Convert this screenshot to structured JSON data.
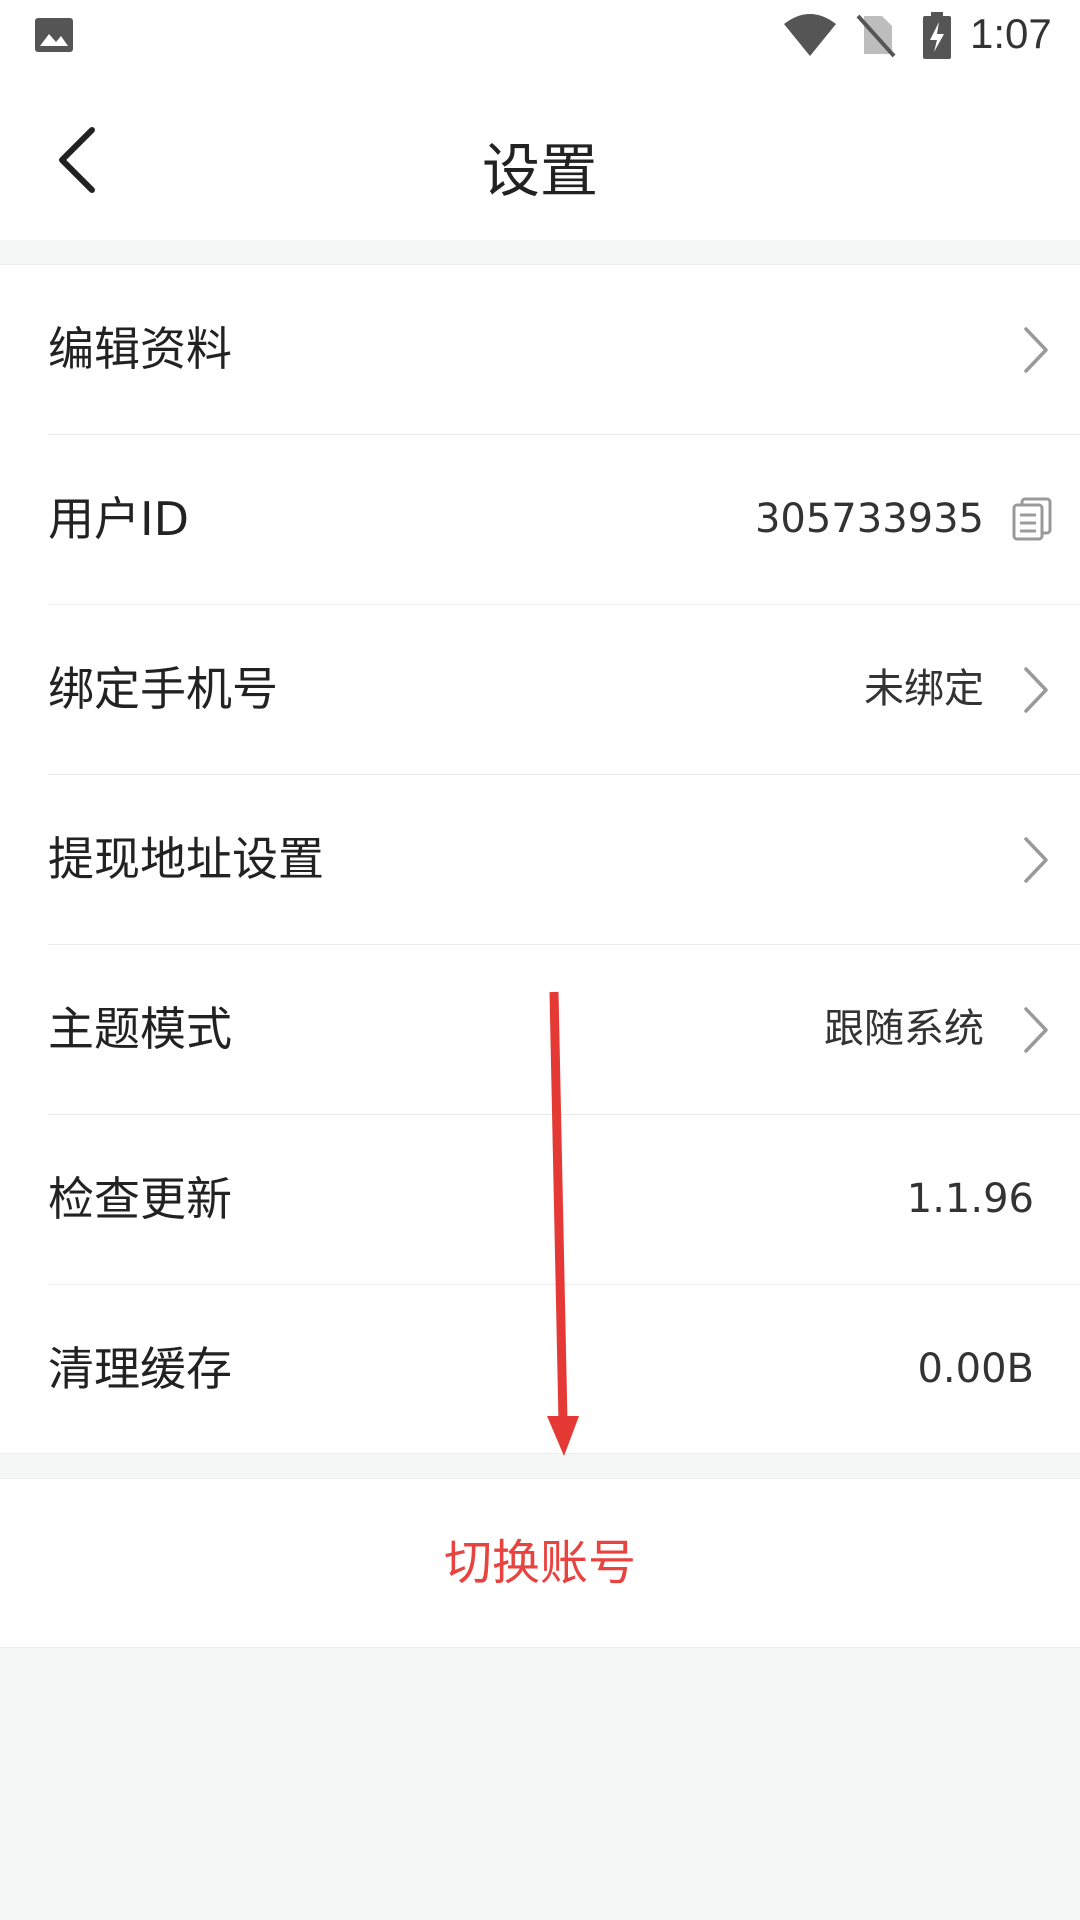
{
  "status_bar": {
    "time": "1:07",
    "icons": [
      "gallery-icon",
      "wifi-icon",
      "no-sim-icon",
      "battery-charging-icon"
    ]
  },
  "header": {
    "title": "设置",
    "back_icon": "back-chevron-icon"
  },
  "settings": {
    "items": [
      {
        "label": "编辑资料",
        "value": "",
        "trailing": "chevron-right-icon"
      },
      {
        "label": "用户ID",
        "value": "305733935",
        "trailing": "copy-icon"
      },
      {
        "label": "绑定手机号",
        "value": "未绑定",
        "trailing": "chevron-right-icon"
      },
      {
        "label": "提现地址设置",
        "value": "",
        "trailing": "chevron-right-icon"
      },
      {
        "label": "主题模式",
        "value": "跟随系统",
        "trailing": "chevron-right-icon"
      },
      {
        "label": "检查更新",
        "value": "1.1.96",
        "trailing": ""
      },
      {
        "label": "清理缓存",
        "value": "0.00B",
        "trailing": ""
      }
    ]
  },
  "actions": {
    "switch_account": "切换账号"
  },
  "colors": {
    "accent_red": "#e8433f",
    "background": "#f5f6f6",
    "annotation_arrow": "#e53935"
  },
  "annotation": {
    "icon": "red-arrow-down-icon"
  }
}
